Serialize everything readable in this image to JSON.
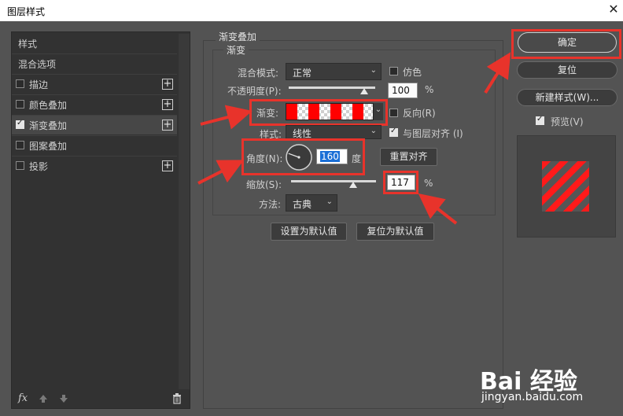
{
  "window": {
    "title": "图层样式",
    "close": "✕"
  },
  "left_panel": {
    "header": "样式",
    "blend_options": "混合选项",
    "items": [
      {
        "label": "描边",
        "checked": false,
        "has_add": true
      },
      {
        "label": "颜色叠加",
        "checked": false,
        "has_add": true
      },
      {
        "label": "渐变叠加",
        "checked": true,
        "has_add": true
      },
      {
        "label": "图案叠加",
        "checked": false,
        "has_add": false
      },
      {
        "label": "投影",
        "checked": false,
        "has_add": true
      }
    ],
    "plus_glyph": "+",
    "fx_label": "fx",
    "icons": [
      "fx-icon",
      "arrow-up-icon",
      "arrow-down-icon",
      "trash-icon"
    ]
  },
  "gradient_overlay": {
    "section_title": "渐变叠加",
    "group_title": "渐变",
    "blend_mode_label": "混合模式:",
    "blend_mode_value": "正常",
    "dither_label": "仿色",
    "dither_checked": false,
    "opacity_label": "不透明度(P):",
    "opacity_value": "100",
    "opacity_percent": 100,
    "percent_sign": "%",
    "gradient_label": "渐变:",
    "reverse_label": "反向(R)",
    "reverse_checked": false,
    "style_label": "样式:",
    "style_value": "线性",
    "align_label": "与图层对齐 (I)",
    "align_checked": true,
    "angle_label": "角度(N):",
    "angle_value": "160",
    "angle_degrees": 160,
    "degree_unit": "度",
    "reset_align_button": "重置对齐",
    "scale_label": "缩放(S):",
    "scale_value": "117",
    "scale_percent": 117,
    "method_label": "方法:",
    "method_value": "古典",
    "set_default_button": "设置为默认值",
    "reset_default_button": "复位为默认值"
  },
  "right_column": {
    "ok_button": "确定",
    "reset_button": "复位",
    "new_style_button": "新建样式(W)...",
    "preview_label": "预览(V)",
    "preview_checked": true
  },
  "colors": {
    "annotation": "#e8332b",
    "gradient_red": "#ff0000",
    "dialog_bg": "#535353",
    "panel_bg": "#323232"
  },
  "watermark": {
    "logo": "Bai 经验",
    "url": "jingyan.baidu.com"
  }
}
